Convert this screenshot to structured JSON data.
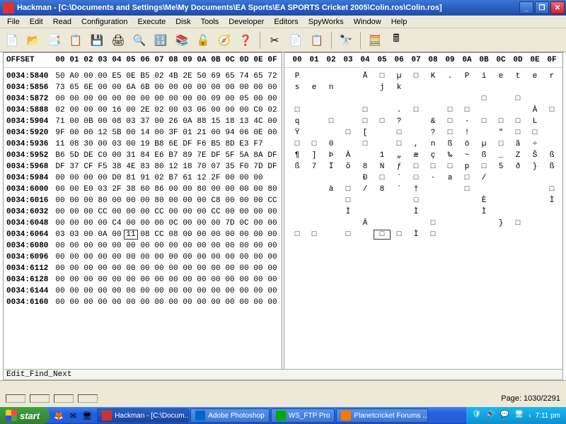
{
  "title": "Hackman - [C:\\Documents and Settings\\Me\\My Documents\\EA Sports\\EA SPORTS Cricket 2005\\Colin.ros\\Colin.ros]",
  "menu": [
    "File",
    "Edit",
    "Read",
    "Configuration",
    "Execute",
    "Disk",
    "Tools",
    "Developer",
    "Editors",
    "SpyWorks",
    "Window",
    "Help"
  ],
  "toolbar": [
    "📄",
    "📂",
    "📑",
    "📋",
    "💾",
    "🖨",
    "🔍",
    "🔢",
    "📚",
    "🔓",
    "🧭",
    "❓",
    "|",
    "✂",
    "📄",
    "📋",
    "|",
    "🔭",
    "|",
    "🧮",
    "🖩"
  ],
  "hex_cols": [
    "00",
    "01",
    "02",
    "03",
    "04",
    "05",
    "06",
    "07",
    "08",
    "09",
    "0A",
    "0B",
    "0C",
    "0D",
    "0E",
    "0F"
  ],
  "offset_label": "OFFSET",
  "rows": [
    {
      "o": "0034:5840",
      "h": [
        "50",
        "A0",
        "00",
        "00",
        "E5",
        "0E",
        "B5",
        "02",
        "4B",
        "2E",
        "50",
        "69",
        "65",
        "74",
        "65",
        "72"
      ],
      "a": [
        "P",
        "",
        "",
        "",
        "Å",
        "□",
        "µ",
        "□",
        "K",
        ".",
        "P",
        "i",
        "e",
        "t",
        "e",
        "r"
      ]
    },
    {
      "o": "0034:5856",
      "h": [
        "73",
        "65",
        "6E",
        "00",
        "00",
        "6A",
        "6B",
        "00",
        "00",
        "00",
        "00",
        "00",
        "00",
        "00",
        "00",
        "00"
      ],
      "a": [
        "s",
        "e",
        "n",
        "",
        "",
        "j",
        "k",
        "",
        "",
        "",
        "",
        "",
        "",
        "",
        "",
        ""
      ]
    },
    {
      "o": "0034:5872",
      "h": [
        "00",
        "00",
        "00",
        "00",
        "00",
        "00",
        "00",
        "00",
        "00",
        "00",
        "00",
        "09",
        "00",
        "05",
        "00",
        "00"
      ],
      "a": [
        "",
        "",
        "",
        "",
        "",
        "",
        "",
        "",
        "",
        "",
        "",
        "□",
        "",
        "□",
        "",
        ""
      ]
    },
    {
      "o": "0034:5888",
      "h": [
        "02",
        "00",
        "00",
        "00",
        "16",
        "00",
        "2E",
        "02",
        "00",
        "03",
        "06",
        "00",
        "00",
        "00",
        "C0",
        "02"
      ],
      "a": [
        "□",
        "",
        "",
        "",
        "□",
        "",
        ".",
        "□",
        "",
        "□",
        "□",
        "",
        "",
        "",
        "À",
        "□"
      ]
    },
    {
      "o": "0034:5904",
      "h": [
        "71",
        "00",
        "0B",
        "00",
        "08",
        "03",
        "37",
        "00",
        "26",
        "0A",
        "88",
        "15",
        "18",
        "13",
        "4C",
        "00"
      ],
      "a": [
        "q",
        "",
        "□",
        "",
        "□",
        "□",
        "?",
        "",
        "&",
        "□",
        "·",
        "□",
        "□",
        "□",
        "L",
        ""
      ]
    },
    {
      "o": "0034:5920",
      "h": [
        "9F",
        "00",
        "00",
        "12",
        "5B",
        "00",
        "14",
        "00",
        "3F",
        "01",
        "21",
        "00",
        "94",
        "06",
        "0E",
        "00"
      ],
      "a": [
        "Ÿ",
        "",
        "",
        "□",
        "[",
        "",
        "□",
        "",
        "?",
        "□",
        "!",
        "",
        "″",
        "□",
        "□",
        ""
      ]
    },
    {
      "o": "0034:5936",
      "h": [
        "11",
        "08",
        "30",
        "00",
        "03",
        "00",
        "19",
        "B8",
        "6E",
        "DF",
        "F6",
        "B5",
        "8D",
        "E3",
        "F7",
        ""
      ],
      "a": [
        "□",
        "□",
        "0",
        "",
        "□",
        "",
        "□",
        ",",
        "n",
        "ß",
        "ö",
        "µ",
        "□",
        "ã",
        "÷",
        ""
      ]
    },
    {
      "o": "0034:5952",
      "h": [
        "B6",
        "5D",
        "DE",
        "C0",
        "00",
        "31",
        "84",
        "E6",
        "B7",
        "89",
        "7E",
        "DF",
        "5F",
        "5A",
        "8A",
        "DF"
      ],
      "a": [
        "¶",
        "]",
        "Þ",
        "À",
        "",
        "1",
        "„",
        "æ",
        "ç",
        "‰",
        "~",
        "ß",
        "_",
        "Z",
        "Š",
        "ß"
      ]
    },
    {
      "o": "0034:5968",
      "h": [
        "DF",
        "37",
        "CF",
        "F5",
        "38",
        "4E",
        "83",
        "80",
        "12",
        "18",
        "70",
        "07",
        "35",
        "F0",
        "7D",
        "DF"
      ],
      "a": [
        "ß",
        "7",
        "Ï",
        "õ",
        "8",
        "N",
        "ƒ",
        "□",
        "□",
        "□",
        "p",
        "□",
        "5",
        "ð",
        "}",
        "ß"
      ]
    },
    {
      "o": "0034:5984",
      "h": [
        "00",
        "00",
        "00",
        "00",
        "D0",
        "81",
        "91",
        "02",
        "B7",
        "61",
        "12",
        "2F",
        "00",
        "00",
        "00",
        ""
      ],
      "a": [
        "",
        "",
        "",
        "",
        "Ð",
        "□",
        "`",
        "□",
        "·",
        "a",
        "□",
        "/",
        "",
        "",
        "",
        ""
      ]
    },
    {
      "o": "0034:6000",
      "h": [
        "00",
        "00",
        "E0",
        "03",
        "2F",
        "38",
        "60",
        "86",
        "00",
        "00",
        "80",
        "00",
        "00",
        "00",
        "00",
        "80"
      ],
      "a": [
        "",
        "",
        "à",
        "□",
        "/",
        "8",
        "`",
        "†",
        "",
        "",
        "□",
        "",
        "",
        "",
        "",
        "□"
      ]
    },
    {
      "o": "0034:6016",
      "h": [
        "00",
        "00",
        "00",
        "80",
        "00",
        "00",
        "00",
        "80",
        "00",
        "00",
        "00",
        "C8",
        "00",
        "00",
        "00",
        "CC"
      ],
      "a": [
        "",
        "",
        "",
        "□",
        "",
        "",
        "",
        "□",
        "",
        "",
        "",
        "È",
        "",
        "",
        "",
        "Ì"
      ]
    },
    {
      "o": "0034:6032",
      "h": [
        "00",
        "00",
        "00",
        "CC",
        "00",
        "00",
        "00",
        "CC",
        "00",
        "00",
        "00",
        "CC",
        "00",
        "00",
        "00",
        "00"
      ],
      "a": [
        "",
        "",
        "",
        "Ì",
        "",
        "",
        "",
        "Ì",
        "",
        "",
        "",
        "Ì",
        "",
        "",
        "",
        ""
      ]
    },
    {
      "o": "0034:6048",
      "h": [
        "00",
        "00",
        "00",
        "00",
        "C4",
        "00",
        "00",
        "00",
        "0C",
        "00",
        "00",
        "00",
        "7D",
        "0C",
        "00",
        "00"
      ],
      "a": [
        "",
        "",
        "",
        "",
        "Ä",
        "",
        "",
        "",
        "□",
        "",
        "",
        "",
        "}",
        "□",
        "",
        ""
      ]
    },
    {
      "o": "0034:6064",
      "h": [
        "03",
        "03",
        "00",
        "0A",
        "00",
        "11",
        "08",
        "CC",
        "08",
        "00",
        "00",
        "00",
        "00",
        "00",
        "00",
        "00"
      ],
      "a": [
        "□",
        "□",
        "",
        "□",
        "",
        "□",
        "□",
        "Ì",
        "□",
        "",
        "",
        "",
        "",
        "",
        "",
        ""
      ]
    },
    {
      "o": "0034:6080",
      "h": [
        "00",
        "00",
        "00",
        "00",
        "00",
        "00",
        "00",
        "00",
        "00",
        "00",
        "00",
        "00",
        "00",
        "00",
        "00",
        "00"
      ],
      "a": [
        "",
        "",
        "",
        "",
        "",
        "",
        "",
        "",
        "",
        "",
        "",
        "",
        "",
        "",
        "",
        ""
      ]
    },
    {
      "o": "0034:6096",
      "h": [
        "00",
        "00",
        "00",
        "00",
        "00",
        "00",
        "00",
        "00",
        "00",
        "00",
        "00",
        "00",
        "00",
        "00",
        "00",
        "00"
      ],
      "a": [
        "",
        "",
        "",
        "",
        "",
        "",
        "",
        "",
        "",
        "",
        "",
        "",
        "",
        "",
        "",
        ""
      ]
    },
    {
      "o": "0034:6112",
      "h": [
        "00",
        "00",
        "00",
        "00",
        "00",
        "00",
        "00",
        "00",
        "00",
        "00",
        "00",
        "00",
        "00",
        "00",
        "00",
        "00"
      ],
      "a": [
        "",
        "",
        "",
        "",
        "",
        "",
        "",
        "",
        "",
        "",
        "",
        "",
        "",
        "",
        "",
        ""
      ]
    },
    {
      "o": "0034:6128",
      "h": [
        "00",
        "00",
        "00",
        "00",
        "00",
        "00",
        "00",
        "00",
        "00",
        "00",
        "00",
        "00",
        "00",
        "00",
        "00",
        "00"
      ],
      "a": [
        "",
        "",
        "",
        "",
        "",
        "",
        "",
        "",
        "",
        "",
        "",
        "",
        "",
        "",
        "",
        ""
      ]
    },
    {
      "o": "0034:6144",
      "h": [
        "00",
        "00",
        "00",
        "00",
        "00",
        "00",
        "00",
        "00",
        "00",
        "00",
        "00",
        "00",
        "00",
        "00",
        "00",
        "00"
      ],
      "a": [
        "",
        "",
        "",
        "",
        "",
        "",
        "",
        "",
        "",
        "",
        "",
        "",
        "",
        "",
        "",
        ""
      ]
    },
    {
      "o": "0034:6160",
      "h": [
        "00",
        "00",
        "00",
        "00",
        "00",
        "00",
        "00",
        "00",
        "00",
        "00",
        "00",
        "00",
        "00",
        "00",
        "00",
        "00"
      ],
      "a": [
        "",
        "",
        "",
        "",
        "",
        "",
        "",
        "",
        "",
        "",
        "",
        "",
        "",
        "",
        "",
        ""
      ]
    }
  ],
  "highlight_row": 14,
  "highlight_col": 5,
  "status_hint": "Edit_Find_Next",
  "page_info": "Page: 1030/2291",
  "start_label": "start",
  "task_buttons": [
    {
      "label": "Hackman - [C:\\Docum...",
      "active": true,
      "color": "#c33"
    },
    {
      "label": "Adobe Photoshop",
      "active": false,
      "color": "#06c"
    },
    {
      "label": "WS_FTP Pro",
      "active": false,
      "color": "#0a0"
    },
    {
      "label": "Planetcricket Forums ...",
      "active": false,
      "color": "#f70"
    }
  ],
  "clock": "7:11 pm"
}
